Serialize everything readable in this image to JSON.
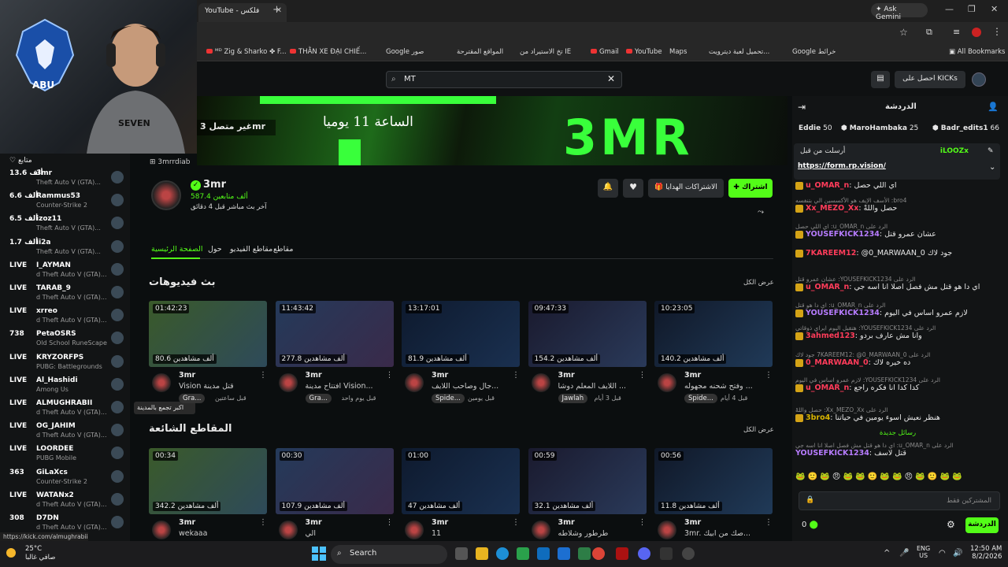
{
  "browser": {
    "tab_title": "YouTube - فلكس",
    "ask_gemini": "Ask Gemini",
    "all_bookmarks": "All Bookmarks",
    "bookmarks": [
      "ᴹᴰ Zig & Sharko ✤ F...",
      "THẰN XE ĐẠI CHIẾ...",
      "Google صور",
      "المواقع المقترحة",
      "تخ الاستيراد من IE",
      "Gmail",
      "YouTube",
      "Maps",
      "تحميل لعبة ديترويت...",
      "Google خرائط"
    ],
    "status_url": "https://kick.com/almughrabii"
  },
  "webcam": {
    "logo_text": "ABU"
  },
  "header": {
    "search_value": "MT",
    "get_kicks": "احصل على KICKs"
  },
  "sidebar": {
    "title": "متابع",
    "channels": [
      {
        "viewers": "13.6 ألف",
        "name": "3mr",
        "game": "Theft Auto V (GTA)..."
      },
      {
        "viewers": "6.6 ألف",
        "name": "Rammus53",
        "game": "Counter-Strike 2"
      },
      {
        "viewers": "6.5 ألف",
        "name": "izoz11",
        "game": "Theft Auto V (GTA)..."
      },
      {
        "viewers": "1.7 ألف",
        "name": "ii2a",
        "game": "Theft Auto V (GTA)..."
      },
      {
        "viewers": "LIVE",
        "name": "I_AYMAN",
        "game": "d Theft Auto V (GTA)..."
      },
      {
        "viewers": "LIVE",
        "name": "TARAB_9",
        "game": "d Theft Auto V (GTA)..."
      },
      {
        "viewers": "LIVE",
        "name": "xrreo",
        "game": "d Theft Auto V (GTA)..."
      },
      {
        "viewers": "738",
        "name": "PetaOSRS",
        "game": "Old School RuneScape"
      },
      {
        "viewers": "LIVE",
        "name": "KRYZORFPS",
        "game": "PUBG: Battlegrounds"
      },
      {
        "viewers": "LIVE",
        "name": "Al_Hashidi",
        "game": "Among Us"
      },
      {
        "viewers": "LIVE",
        "name": "ALMUGHRABII",
        "game": "d Theft Auto V (GTA)..."
      },
      {
        "viewers": "LIVE",
        "name": "OG_JAHIM",
        "game": "d Theft Auto V (GTA)..."
      },
      {
        "viewers": "LIVE",
        "name": "LOORDEE",
        "game": "PUBG Mobile"
      },
      {
        "viewers": "363",
        "name": "GiLaXcs",
        "game": "Counter-Strike 2"
      },
      {
        "viewers": "LIVE",
        "name": "WATANx2",
        "game": "d Theft Auto V (GTA)..."
      },
      {
        "viewers": "308",
        "name": "D7DN",
        "game": "d Theft Auto V (GTA)..."
      }
    ],
    "tooltip": "اكبر تجمع بالمدينة"
  },
  "banner": {
    "offline": "غير متصل 3mr",
    "schedule": "الساعة 11 يوميا",
    "logo": "3MR",
    "handle": "3mrrdiab"
  },
  "channel": {
    "name": "3mr",
    "followers": "587.4 ألف متابعين",
    "last_live": "آخر بث مباشر قبل 4 دقائق",
    "follow": "اشتراك",
    "subscriptions": "الاشتراكات الهدايا"
  },
  "tabs": [
    "الصفحة الرئيسية",
    "حول",
    "مقاطع الفيديو",
    "مقاطع"
  ],
  "streams_section": {
    "title": "بث فيديوهات",
    "see_all": "عرض الكل",
    "videos": [
      {
        "duration": "01:42:23",
        "views": "80.6 ألف مشاهدين",
        "channel": "3mr",
        "title": "Vision قتل مدينة",
        "category": "Gra...",
        "time": "قبل ساعتين"
      },
      {
        "duration": "11:43:42",
        "views": "277.8 ألف مشاهدين",
        "channel": "3mr",
        "title": "افتتاح مدينة Vision...",
        "category": "Gra...",
        "time": "قبل يوم واحد"
      },
      {
        "duration": "13:17:01",
        "views": "81.9 ألف مشاهدين",
        "channel": "3mr",
        "title": "جال وصاحب اللايف...",
        "category": "Spide...",
        "time": "قبل يومين"
      },
      {
        "duration": "09:47:33",
        "views": "154.2 ألف مشاهدين",
        "channel": "3mr",
        "title": "اللايف المعلم دوشا ...",
        "category": "Jawlah",
        "time": "قبل 3 أيام"
      },
      {
        "duration": "10:23:05",
        "views": "140.2 ألف مشاهدين",
        "channel": "3mr",
        "title": "وفتح شحنه مجهوله ...",
        "category": "Spide...",
        "time": "قبل 4 أيام"
      }
    ]
  },
  "clips_section": {
    "title": "المقاطع الشائعة",
    "see_all": "عرض الكل",
    "clips": [
      {
        "duration": "00:34",
        "views": "342.2 ألف مشاهدين",
        "channel": "3mr",
        "title": "wekaaa"
      },
      {
        "duration": "00:30",
        "views": "107.9 ألف مشاهدين",
        "channel": "3mr",
        "title": "الي"
      },
      {
        "duration": "01:00",
        "views": "47 ألف مشاهدين",
        "channel": "3mr",
        "title": "11"
      },
      {
        "duration": "00:59",
        "views": "32.1 ألف مشاهدين",
        "channel": "3mr",
        "title": "طرطور وشلاطه"
      },
      {
        "duration": "00:56",
        "views": "11.8 ألف مشاهدين",
        "channel": "3mr",
        "title": "3mr. صك من ابيك..."
      }
    ]
  },
  "chat": {
    "title": "الدردشة",
    "gifters": [
      {
        "name": "Eddie",
        "count": "50"
      },
      {
        "name": "MaroHambaka",
        "count": "25"
      },
      {
        "name": "Badr_edits1",
        "count": "66"
      }
    ],
    "pinned_user": "iLOOZx",
    "pinned_label": "أرسلت من قبل",
    "pinned_link": "https://form.rp.vision/",
    "messages": [
      {
        "reply": "",
        "user": "u_OMAR_n",
        "color": "#ff3c5a",
        "text": "اي اللي حصل"
      },
      {
        "reply": "bro4: الأسف الإيف هو الأكسسين الي بتنفسه",
        "user": "Xx_MEZO_Xx",
        "color": "#ff3c5a",
        "text": "حصل واللهْ"
      },
      {
        "reply": "الرد على u_OMAR_n: اي اللي حصل",
        "user": "YOUSEFKICK1234",
        "color": "#b77cff",
        "text": "عشان عمرو قتل"
      },
      {
        "reply": "",
        "user": "7KAREEM12",
        "color": "#ff3c5a",
        "text": "@0_MARWAAN_0 جود لاك"
      },
      {
        "reply": "الرد على YOUSEFKICK1234: عشان عمرو قتل",
        "user": "u_OMAR_n",
        "color": "#ff3c5a",
        "text": "اي دا هو قتل مش فصل اصلا انا اسه جي"
      },
      {
        "reply": "الرد على u_OMAR_n: اي دا هو قتل",
        "user": "YOUSEFKICK1234",
        "color": "#b77cff",
        "text": "لازم عمرو اساس في اليوم"
      },
      {
        "reply": "الرد على YOUSEFKICK1234: هتقيل اليوم ايراي ذوقاتي",
        "user": "3ahmed123",
        "color": "#ff3c5a",
        "text": "وانا مش عارف بردو"
      },
      {
        "reply": "الرد على 7KAREEM12: @0_MARWAAN_0 جود لاك",
        "user": "0_MARWAAN_0",
        "color": "#ff3c5a",
        "text": "ده خيره لاك"
      },
      {
        "reply": "الرد على YOUSEFKICK1234: لازم عمرو اساس في اليوم",
        "user": "u_OMAR_n",
        "color": "#ff3c5a",
        "text": "كدا كدا انا فكره راجع"
      },
      {
        "reply": "الرد على Xx_MEZO_Xx: حصل واللهْ",
        "user": "3bro4",
        "color": "#d8b400",
        "text": "هنظر نعيش اسوء يومين في حياتنا"
      }
    ],
    "new_messages": "رسائل جديدة",
    "last_reply": "الرد على u_OMAR_n: اي دا هو قتل مش فصل اصلا انا اسه جي",
    "last_user": "YOUSEFKICK1234",
    "last_text": "قتل لاسف",
    "input_placeholder": "المشتركين فقط",
    "send": "الدردشة",
    "points": "0"
  },
  "taskbar": {
    "temp": "25°C",
    "weather": "صافي غالبا",
    "search": "Search",
    "lang": "ENG",
    "region": "US",
    "time": "12:50 AM",
    "date": "8/2/2026"
  },
  "colors": {
    "kick_green": "#53fc18",
    "bg": "#0b0e0f",
    "panel": "#121415"
  }
}
